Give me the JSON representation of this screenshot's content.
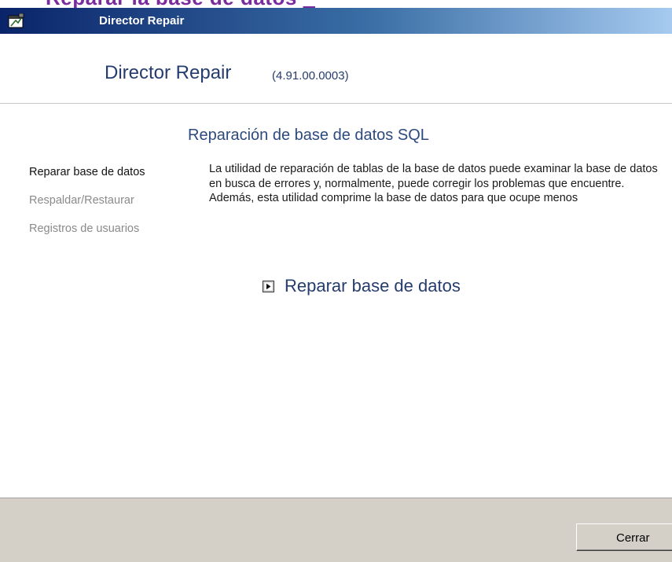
{
  "top_strip": {
    "cropped_heading": "Reparar la base de datos"
  },
  "window": {
    "title": "Director Repair"
  },
  "header": {
    "app_name": "Director Repair",
    "version": "(4.91.00.0003)"
  },
  "section": {
    "title": "Reparación de base de datos SQL"
  },
  "sidebar": {
    "items": [
      {
        "label": "Reparar base de datos",
        "state": "active"
      },
      {
        "label": "Respaldar/Restaurar",
        "state": "inactive"
      },
      {
        "label": "Registros de usuarios",
        "state": "inactive"
      }
    ]
  },
  "main": {
    "description": "La utilidad de reparación de tablas de la base de datos puede examinar la base de datos en busca de errores y, normalmente, puede corregir los problemas que encuentre.  Además, esta utilidad comprime la base de datos para que ocupe menos",
    "action_label": "Reparar base de datos",
    "action_icon": "arrow-right-box-icon"
  },
  "footer": {
    "close_label": "Cerrar"
  },
  "colors": {
    "titlebar_start": "#0a246a",
    "titlebar_end": "#a6caf0",
    "heading_text": "#253c6e",
    "cropped_heading": "#7a2c9e",
    "footer_bg": "#d4d0c8"
  }
}
